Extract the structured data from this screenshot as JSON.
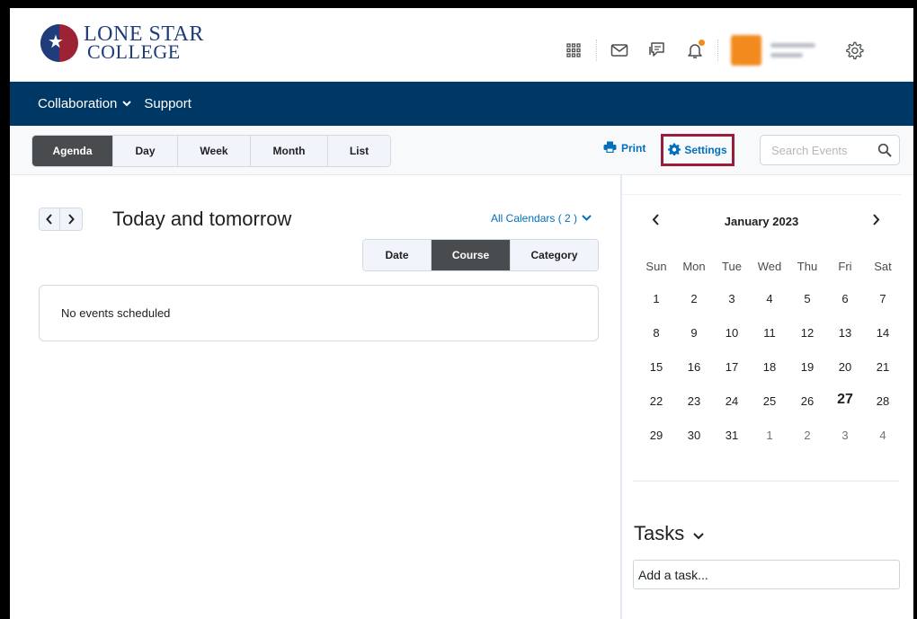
{
  "brand": {
    "line1": "LONE STAR",
    "line2": "COLLEGE",
    "mark_text": "LONE STAR COLLEGE"
  },
  "header": {
    "icons": [
      "apps-grid-icon",
      "mail-icon",
      "chat-icon",
      "bell-icon",
      "gear-icon"
    ],
    "accent": "#f28a1e"
  },
  "nav": {
    "items": [
      {
        "label": "Collaboration",
        "has_dropdown": true
      },
      {
        "label": "Support",
        "has_dropdown": false
      }
    ],
    "background": "#003865"
  },
  "toolbar": {
    "view_tabs": [
      {
        "label": "Agenda",
        "active": true
      },
      {
        "label": "Day",
        "active": false
      },
      {
        "label": "Week",
        "active": false
      },
      {
        "label": "Month",
        "active": false
      },
      {
        "label": "List",
        "active": false
      }
    ],
    "print_label": "Print",
    "settings_label": "Settings",
    "search_placeholder": "Search Events",
    "highlight_color": "#9b1b3a"
  },
  "agenda": {
    "range_title": "Today and tomorrow",
    "all_calendars_label": "All Calendars ( 2 )",
    "group_tabs": [
      {
        "label": "Date",
        "active": false
      },
      {
        "label": "Course",
        "active": true
      },
      {
        "label": "Category",
        "active": false
      }
    ],
    "empty_message": "No events scheduled"
  },
  "mini_calendar": {
    "month_label": "January 2023",
    "weekdays": [
      "Sun",
      "Mon",
      "Tue",
      "Wed",
      "Thu",
      "Fri",
      "Sat"
    ],
    "weeks": [
      [
        {
          "d": "1"
        },
        {
          "d": "2"
        },
        {
          "d": "3"
        },
        {
          "d": "4"
        },
        {
          "d": "5"
        },
        {
          "d": "6"
        },
        {
          "d": "7"
        }
      ],
      [
        {
          "d": "8"
        },
        {
          "d": "9"
        },
        {
          "d": "10"
        },
        {
          "d": "11"
        },
        {
          "d": "12"
        },
        {
          "d": "13"
        },
        {
          "d": "14"
        }
      ],
      [
        {
          "d": "15"
        },
        {
          "d": "16"
        },
        {
          "d": "17"
        },
        {
          "d": "18"
        },
        {
          "d": "19"
        },
        {
          "d": "20"
        },
        {
          "d": "21"
        }
      ],
      [
        {
          "d": "22"
        },
        {
          "d": "23"
        },
        {
          "d": "24"
        },
        {
          "d": "25"
        },
        {
          "d": "26"
        },
        {
          "d": "27",
          "today": true
        },
        {
          "d": "28"
        }
      ],
      [
        {
          "d": "29"
        },
        {
          "d": "30"
        },
        {
          "d": "31"
        },
        {
          "d": "1",
          "dim": true
        },
        {
          "d": "2",
          "dim": true
        },
        {
          "d": "3",
          "dim": true
        },
        {
          "d": "4",
          "dim": true
        }
      ]
    ]
  },
  "tasks": {
    "title": "Tasks",
    "input_placeholder": "Add a task..."
  }
}
